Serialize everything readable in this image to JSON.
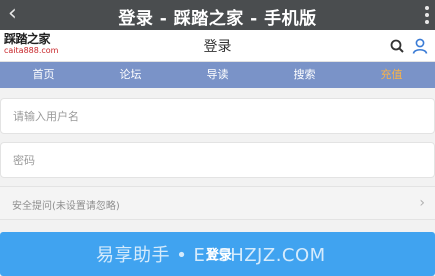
{
  "titlebar": {
    "back_icon": "chevron-left-icon",
    "title": "登录 - 踩踏之家 - 手机版",
    "menu_icon": "vertical-dots-icon"
  },
  "header": {
    "logo_line1": "踩踏之家",
    "logo_line2": "caita888.com",
    "page_title": "登录",
    "search_icon": "search-icon",
    "user_icon": "user-icon"
  },
  "nav": {
    "items": [
      {
        "label": "首页"
      },
      {
        "label": "论坛"
      },
      {
        "label": "导读"
      },
      {
        "label": "搜索"
      },
      {
        "label": "充值"
      }
    ],
    "highlight_color": "#f7b24a"
  },
  "form": {
    "username_placeholder": "请输入用户名",
    "password_placeholder": "密码",
    "security_question": "安全提问(未设置请忽略)",
    "login_label": "登录"
  },
  "watermark": "易享助手 • EXSHZJZ.COM",
  "colors": {
    "titlebar": "#4a4d4f",
    "nav": "#7a93c8",
    "login": "#40a3f0"
  }
}
